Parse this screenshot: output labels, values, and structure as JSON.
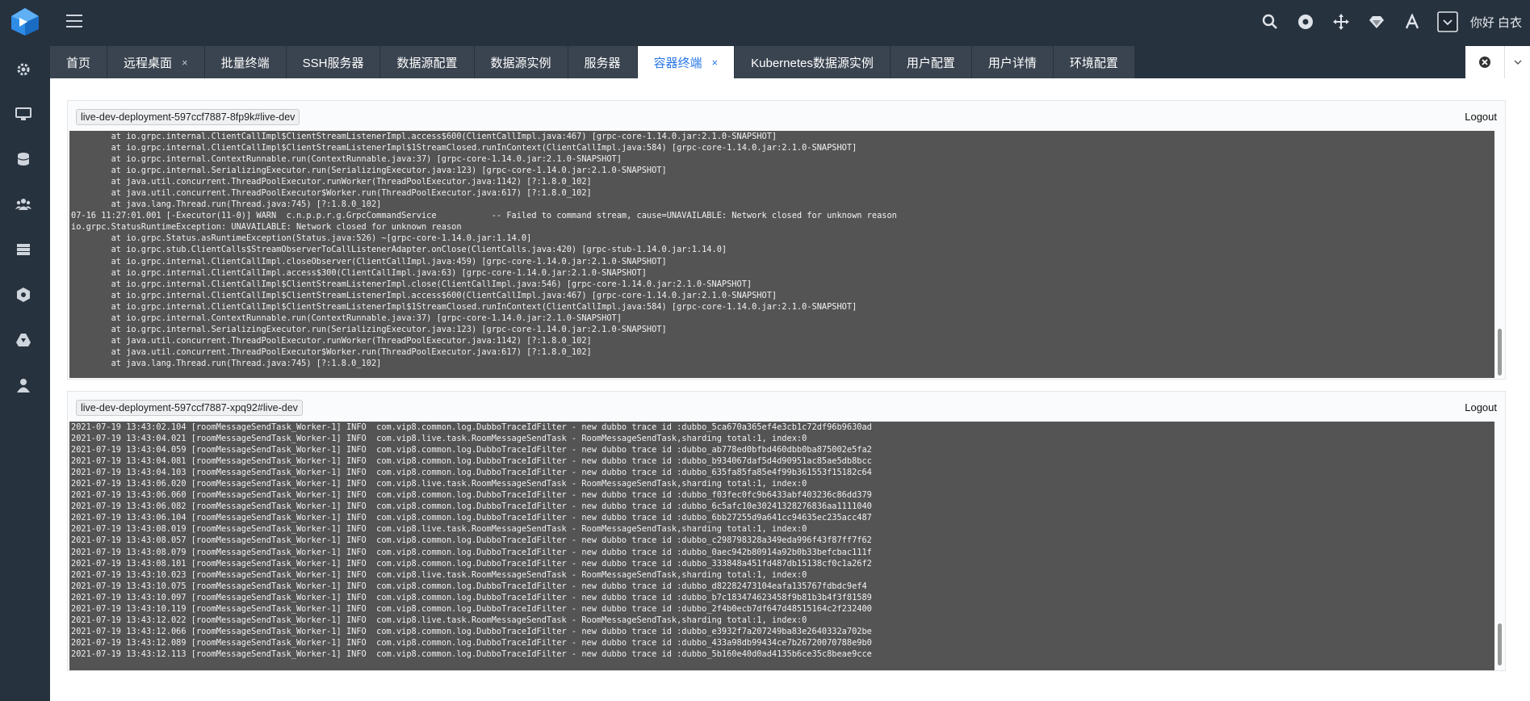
{
  "header": {
    "greeting": "你好 白衣",
    "icons": [
      "search-icon",
      "record-icon",
      "move-icon",
      "diamond-icon",
      "font-icon",
      "dropdown-box-icon"
    ]
  },
  "sidebar": {
    "items": [
      "gear-icon",
      "monitor-icon",
      "database-icon",
      "users-icon",
      "server-icon",
      "cluster-icon",
      "drive-icon",
      "user-icon"
    ]
  },
  "tabs": [
    {
      "label": "首页",
      "closable": false
    },
    {
      "label": "远程桌面",
      "closable": true,
      "close_glyph": "×"
    },
    {
      "label": "批量终端",
      "closable": false
    },
    {
      "label": "SSH服务器",
      "closable": false
    },
    {
      "label": "数据源配置",
      "closable": false
    },
    {
      "label": "数据源实例",
      "closable": false
    },
    {
      "label": "服务器",
      "closable": false
    },
    {
      "label": "容器终端",
      "closable": true,
      "active": true,
      "close_glyph": "×"
    },
    {
      "label": "Kubernetes数据源实例",
      "closable": false
    },
    {
      "label": "用户配置",
      "closable": false
    },
    {
      "label": "用户详情",
      "closable": false
    },
    {
      "label": "环境配置",
      "closable": false
    }
  ],
  "colors": {
    "sidebar_bg": "#27323f",
    "tab_bg": "#3a4450",
    "accent": "#2a78e4",
    "terminal_bg": "#545454"
  },
  "terminals": [
    {
      "host": "live-dev-deployment-597ccf7887-8fp9k#live-dev",
      "logout": "Logout",
      "lines": [
        "        at io.grpc.internal.ClientCallImpl$ClientStreamListenerImpl.access$600(ClientCallImpl.java:467) [grpc-core-1.14.0.jar:2.1.0-SNAPSHOT]",
        "        at io.grpc.internal.ClientCallImpl$ClientStreamListenerImpl$1StreamClosed.runInContext(ClientCallImpl.java:584) [grpc-core-1.14.0.jar:2.1.0-SNAPSHOT]",
        "        at io.grpc.internal.ContextRunnable.run(ContextRunnable.java:37) [grpc-core-1.14.0.jar:2.1.0-SNAPSHOT]",
        "        at io.grpc.internal.SerializingExecutor.run(SerializingExecutor.java:123) [grpc-core-1.14.0.jar:2.1.0-SNAPSHOT]",
        "        at java.util.concurrent.ThreadPoolExecutor.runWorker(ThreadPoolExecutor.java:1142) [?:1.8.0_102]",
        "        at java.util.concurrent.ThreadPoolExecutor$Worker.run(ThreadPoolExecutor.java:617) [?:1.8.0_102]",
        "        at java.lang.Thread.run(Thread.java:745) [?:1.8.0_102]",
        "07-16 11:27:01.001 [-Executor(11-0)] WARN  c.n.p.p.r.g.GrpcCommandService           -- Failed to command stream, cause=UNAVAILABLE: Network closed for unknown reason",
        "io.grpc.StatusRuntimeException: UNAVAILABLE: Network closed for unknown reason",
        "        at io.grpc.Status.asRuntimeException(Status.java:526) ~[grpc-core-1.14.0.jar:1.14.0]",
        "        at io.grpc.stub.ClientCalls$StreamObserverToCallListenerAdapter.onClose(ClientCalls.java:420) [grpc-stub-1.14.0.jar:1.14.0]",
        "        at io.grpc.internal.ClientCallImpl.closeObserver(ClientCallImpl.java:459) [grpc-core-1.14.0.jar:2.1.0-SNAPSHOT]",
        "        at io.grpc.internal.ClientCallImpl.access$300(ClientCallImpl.java:63) [grpc-core-1.14.0.jar:2.1.0-SNAPSHOT]",
        "        at io.grpc.internal.ClientCallImpl$ClientStreamListenerImpl.close(ClientCallImpl.java:546) [grpc-core-1.14.0.jar:2.1.0-SNAPSHOT]",
        "        at io.grpc.internal.ClientCallImpl$ClientStreamListenerImpl.access$600(ClientCallImpl.java:467) [grpc-core-1.14.0.jar:2.1.0-SNAPSHOT]",
        "        at io.grpc.internal.ClientCallImpl$ClientStreamListenerImpl$1StreamClosed.runInContext(ClientCallImpl.java:584) [grpc-core-1.14.0.jar:2.1.0-SNAPSHOT]",
        "        at io.grpc.internal.ContextRunnable.run(ContextRunnable.java:37) [grpc-core-1.14.0.jar:2.1.0-SNAPSHOT]",
        "        at io.grpc.internal.SerializingExecutor.run(SerializingExecutor.java:123) [grpc-core-1.14.0.jar:2.1.0-SNAPSHOT]",
        "        at java.util.concurrent.ThreadPoolExecutor.runWorker(ThreadPoolExecutor.java:1142) [?:1.8.0_102]",
        "        at java.util.concurrent.ThreadPoolExecutor$Worker.run(ThreadPoolExecutor.java:617) [?:1.8.0_102]",
        "        at java.lang.Thread.run(Thread.java:745) [?:1.8.0_102]",
        "_"
      ]
    },
    {
      "host": "live-dev-deployment-597ccf7887-xpq92#live-dev",
      "logout": "Logout",
      "lines": [
        "2021-07-19 13:43:02.104 [roomMessageSendTask_Worker-1] INFO  com.vip8.common.log.DubboTraceIdFilter - new dubbo trace id :dubbo_5ca670a365ef4e3cb1c72df96b9630ad",
        "2021-07-19 13:43:04.021 [roomMessageSendTask_Worker-1] INFO  com.vip8.live.task.RoomMessageSendTask - RoomMessageSendTask,sharding total:1, index:0",
        "2021-07-19 13:43:04.059 [roomMessageSendTask_Worker-1] INFO  com.vip8.common.log.DubboTraceIdFilter - new dubbo trace id :dubbo_ab778ed0bfbd460dbb0ba875002e5fa2",
        "2021-07-19 13:43:04.081 [roomMessageSendTask_Worker-1] INFO  com.vip8.common.log.DubboTraceIdFilter - new dubbo trace id :dubbo_b934067daf5d4d90951ac85ae5db8bcc",
        "2021-07-19 13:43:04.103 [roomMessageSendTask_Worker-1] INFO  com.vip8.common.log.DubboTraceIdFilter - new dubbo trace id :dubbo_635fa85fa85e4f99b361553f15182c64",
        "2021-07-19 13:43:06.020 [roomMessageSendTask_Worker-1] INFO  com.vip8.live.task.RoomMessageSendTask - RoomMessageSendTask,sharding total:1, index:0",
        "2021-07-19 13:43:06.060 [roomMessageSendTask_Worker-1] INFO  com.vip8.common.log.DubboTraceIdFilter - new dubbo trace id :dubbo_f03fec0fc9b6433abf403236c86dd379",
        "2021-07-19 13:43:06.082 [roomMessageSendTask_Worker-1] INFO  com.vip8.common.log.DubboTraceIdFilter - new dubbo trace id :dubbo_6c5afc10e30241328276836aa1111040",
        "2021-07-19 13:43:06.104 [roomMessageSendTask_Worker-1] INFO  com.vip8.common.log.DubboTraceIdFilter - new dubbo trace id :dubbo_6bb27255d9a641cc94635ec235acc487",
        "2021-07-19 13:43:08.019 [roomMessageSendTask_Worker-1] INFO  com.vip8.live.task.RoomMessageSendTask - RoomMessageSendTask,sharding total:1, index:0",
        "2021-07-19 13:43:08.057 [roomMessageSendTask_Worker-1] INFO  com.vip8.common.log.DubboTraceIdFilter - new dubbo trace id :dubbo_c298798328a349eda996f43f87ff7f62",
        "2021-07-19 13:43:08.079 [roomMessageSendTask_Worker-1] INFO  com.vip8.common.log.DubboTraceIdFilter - new dubbo trace id :dubbo_0aec942b80914a92b0b33befcbac111f",
        "2021-07-19 13:43:08.101 [roomMessageSendTask_Worker-1] INFO  com.vip8.common.log.DubboTraceIdFilter - new dubbo trace id :dubbo_333848a451fd487db15138cf0c1a26f2",
        "2021-07-19 13:43:10.023 [roomMessageSendTask_Worker-1] INFO  com.vip8.live.task.RoomMessageSendTask - RoomMessageSendTask,sharding total:1, index:0",
        "2021-07-19 13:43:10.075 [roomMessageSendTask_Worker-1] INFO  com.vip8.common.log.DubboTraceIdFilter - new dubbo trace id :dubbo_d82282473104eafa135767fdbdc9ef4",
        "2021-07-19 13:43:10.097 [roomMessageSendTask_Worker-1] INFO  com.vip8.common.log.DubboTraceIdFilter - new dubbo trace id :dubbo_b7c183474623458f9b81b3b4f3f81589",
        "2021-07-19 13:43:10.119 [roomMessageSendTask_Worker-1] INFO  com.vip8.common.log.DubboTraceIdFilter - new dubbo trace id :dubbo_2f4b0ecb7df647d48515164c2f232400",
        "2021-07-19 13:43:12.022 [roomMessageSendTask_Worker-1] INFO  com.vip8.live.task.RoomMessageSendTask - RoomMessageSendTask,sharding total:1, index:0",
        "2021-07-19 13:43:12.066 [roomMessageSendTask_Worker-1] INFO  com.vip8.common.log.DubboTraceIdFilter - new dubbo trace id :dubbo_e3932f7a207249ba83e2640332a702be",
        "2021-07-19 13:43:12.089 [roomMessageSendTask_Worker-1] INFO  com.vip8.common.log.DubboTraceIdFilter - new dubbo trace id :dubbo_433a98db99434ce7b26720070788e9b0",
        "2021-07-19 13:43:12.113 [roomMessageSendTask_Worker-1] INFO  com.vip8.common.log.DubboTraceIdFilter - new dubbo trace id :dubbo_5b160e40d0ad4135b6ce35c8beae9cce"
      ]
    }
  ]
}
